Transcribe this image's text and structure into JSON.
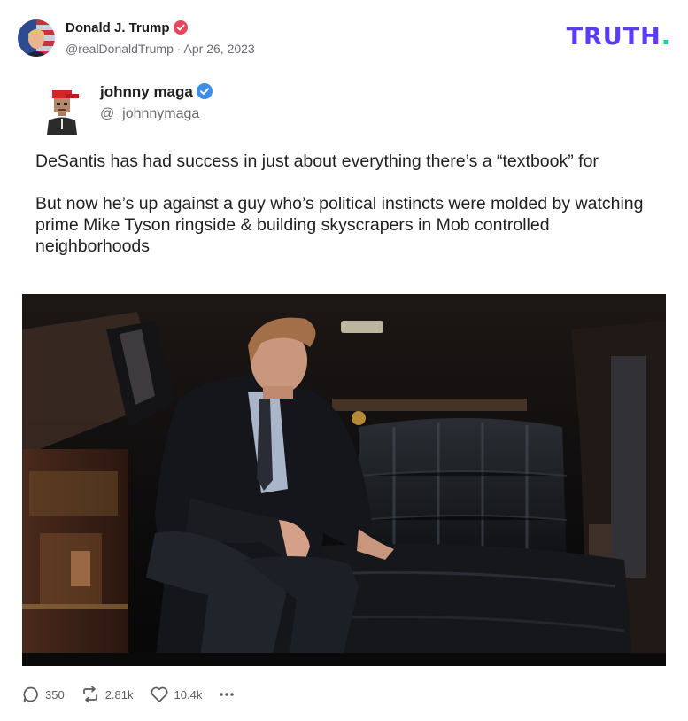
{
  "post": {
    "author_name": "Donald J. Trump",
    "author_handle": "@realDonaldTrump",
    "separator": "·",
    "date": "Apr 26, 2023",
    "brand": "TRUTH",
    "brand_dot": "."
  },
  "quoted": {
    "name": "johnny maga",
    "handle": "@_johnnymaga",
    "paragraphs": [
      "DeSantis has had success in just about everything there’s a “textbook” for",
      "But now he’s up against a guy who’s political instincts were molded by watching prime Mike Tyson ringside & building skyscrapers in Mob controlled neighborhoods"
    ]
  },
  "actions": {
    "replies": "350",
    "retruths": "2.81k",
    "likes": "10.4k"
  },
  "icons": {
    "author_verified": "verified-badge-icon",
    "quoted_verified": "verified-badge-icon",
    "reply": "reply-icon",
    "retruth": "retruth-icon",
    "like": "heart-icon",
    "more": "more-options-icon"
  },
  "colors": {
    "brand": "#5c3bff",
    "brand_dot": "#16d3b0",
    "author_badge": "#e8455e",
    "quoted_badge": "#3b8fe8",
    "muted_text": "#6b6b73"
  }
}
